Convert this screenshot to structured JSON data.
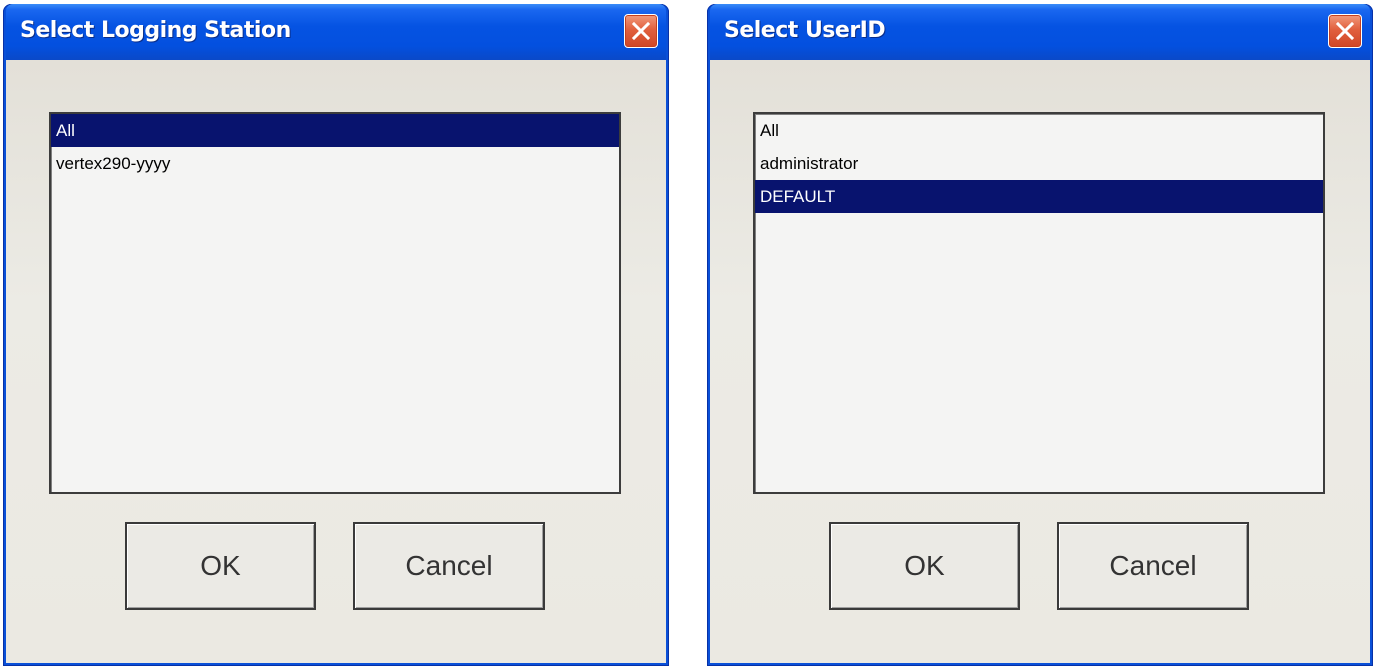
{
  "dialogs": [
    {
      "title": "Select Logging Station",
      "items": [
        "All",
        "vertex290-yyyy"
      ],
      "selected_index": 0,
      "ok_label": "OK",
      "cancel_label": "Cancel"
    },
    {
      "title": "Select UserID",
      "items": [
        "All",
        "administrator",
        "DEFAULT"
      ],
      "selected_index": 2,
      "ok_label": "OK",
      "cancel_label": "Cancel"
    }
  ],
  "colors": {
    "titlebar_blue": "#0553e2",
    "selection_navy": "#08136e",
    "client_bg": "#ebe9e2",
    "close_red": "#e1603e"
  },
  "icons": {
    "close": "close-icon"
  }
}
